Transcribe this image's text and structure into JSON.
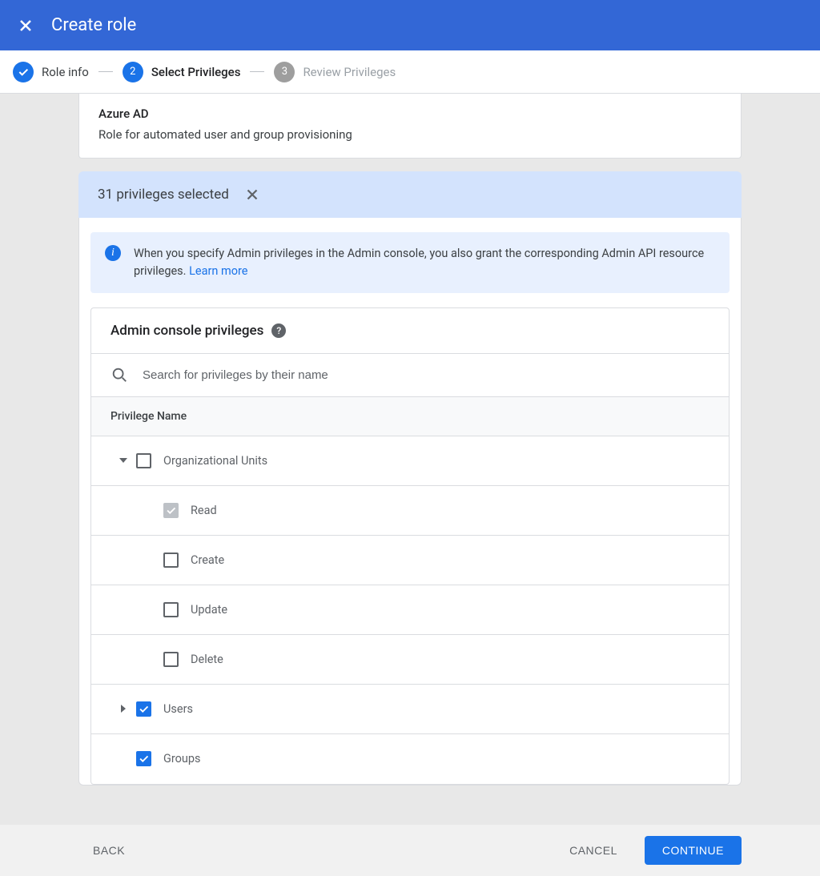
{
  "header": {
    "title": "Create role"
  },
  "stepper": {
    "step1": {
      "label": "Role info"
    },
    "step2": {
      "label": "Select Privileges",
      "number": "2"
    },
    "step3": {
      "label": "Review Privileges",
      "number": "3"
    }
  },
  "role_summary": {
    "name": "Azure AD",
    "description": "Role for automated user and group provisioning"
  },
  "selection": {
    "text": "31 privileges selected"
  },
  "info_banner": {
    "text": "When you specify Admin privileges in the Admin console, you also grant the corresponding Admin API resource privileges. ",
    "link_text": "Learn more"
  },
  "privileges_section": {
    "title": "Admin console privileges",
    "search_placeholder": "Search for privileges by their name",
    "column_header": "Privilege Name",
    "rows": {
      "org_units": "Organizational Units",
      "read": "Read",
      "create": "Create",
      "update": "Update",
      "delete": "Delete",
      "users": "Users",
      "groups": "Groups"
    }
  },
  "footer": {
    "back": "BACK",
    "cancel": "CANCEL",
    "continue": "CONTINUE"
  }
}
